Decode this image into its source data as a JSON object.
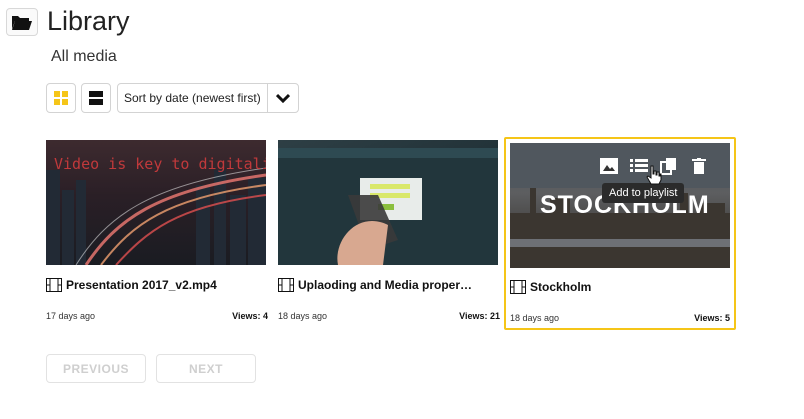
{
  "header": {
    "title": "Library",
    "subtitle": "All media",
    "icon": "folder-open-icon"
  },
  "toolbar": {
    "grid_view_icon": "grid-view-icon",
    "list_view_icon": "list-view-icon",
    "sort_label": "Sort by date (newest first)",
    "accent_color": "#f5c518"
  },
  "media": [
    {
      "title": "Presentation 2017_v2.mp4",
      "date": "17 days ago",
      "views": "Views: 4",
      "thumb_text": "Video is key to digitalization"
    },
    {
      "title": "Uplaoding and Media proper…",
      "date": "18 days ago",
      "views": "Views: 21"
    },
    {
      "title": "Stockholm",
      "date": "18 days ago",
      "views": "Views: 5",
      "thumb_text": "STOCKHOLM",
      "selected": true
    }
  ],
  "overlay": {
    "tooltip": "Add to playlist"
  },
  "pager": {
    "previous": "PREVIOUS",
    "next": "NEXT"
  }
}
